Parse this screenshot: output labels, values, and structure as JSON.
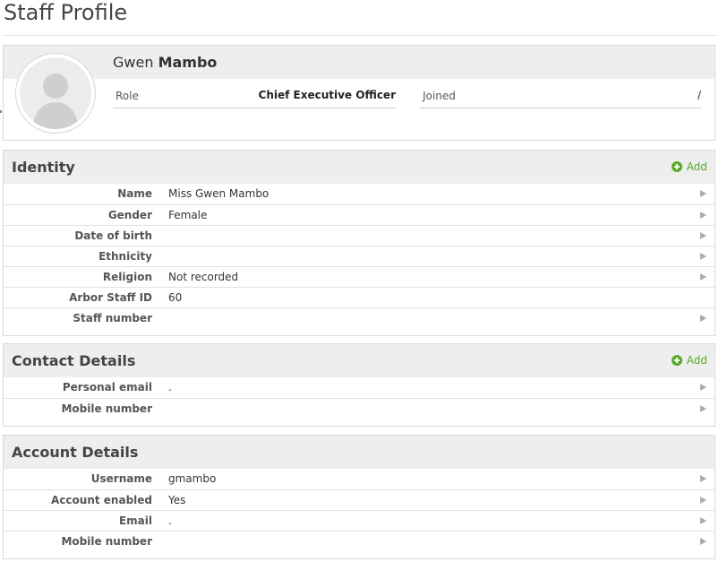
{
  "page": {
    "title": "Staff Profile"
  },
  "profile": {
    "first_name": "Gwen",
    "last_name": "Mambo",
    "role_label": "Role",
    "role_value": "Chief Executive Officer",
    "joined_label": "Joined",
    "joined_value": "/"
  },
  "identity": {
    "title": "Identity",
    "add_label": "Add",
    "rows": [
      {
        "label": "Name",
        "value": "Miss Gwen Mambo",
        "arrow": true
      },
      {
        "label": "Gender",
        "value": "Female",
        "arrow": true
      },
      {
        "label": "Date of birth",
        "value": "",
        "arrow": true
      },
      {
        "label": "Ethnicity",
        "value": "",
        "arrow": true
      },
      {
        "label": "Religion",
        "value": "Not recorded",
        "arrow": true
      },
      {
        "label": "Arbor Staff ID",
        "value": "60",
        "arrow": false
      },
      {
        "label": "Staff number",
        "value": "",
        "arrow": true
      }
    ]
  },
  "contact": {
    "title": "Contact Details",
    "add_label": "Add",
    "rows": [
      {
        "label": "Personal email",
        "value": ".",
        "arrow": true
      },
      {
        "label": "Mobile number",
        "value": "",
        "arrow": true
      }
    ]
  },
  "account": {
    "title": "Account Details",
    "rows": [
      {
        "label": "Username",
        "value": "gmambo",
        "arrow": true
      },
      {
        "label": "Account enabled",
        "value": "Yes",
        "arrow": true
      },
      {
        "label": "Email",
        "value": ".",
        "arrow": true
      },
      {
        "label": "Mobile number",
        "value": "",
        "arrow": true
      }
    ]
  },
  "colors": {
    "accent_green": "#5aab2a",
    "band_gray": "#eeeeee"
  }
}
